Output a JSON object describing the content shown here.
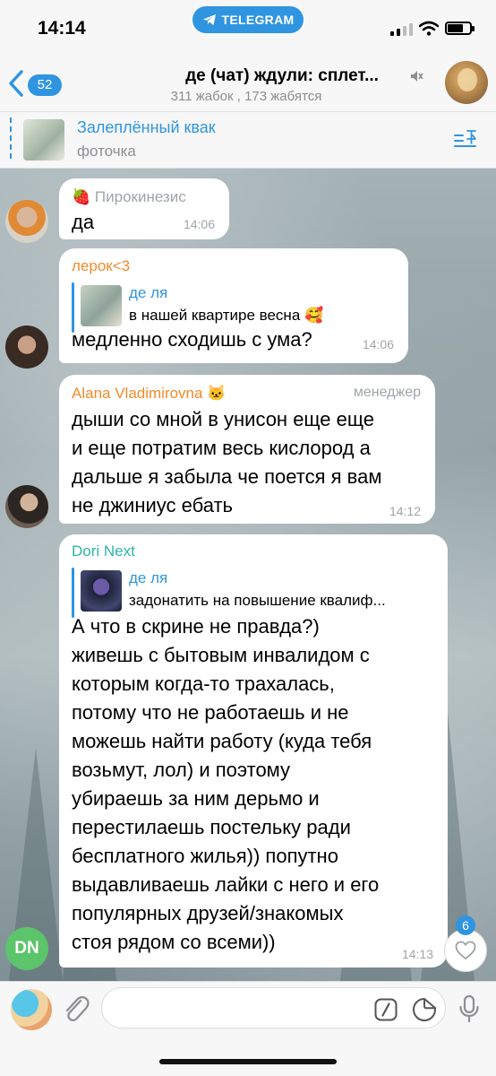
{
  "status_bar": {
    "time": "14:14",
    "app_pill": "TELEGRAM",
    "accent_color": "#2f95e1"
  },
  "header": {
    "back_badge": "52",
    "title": "де (чат) ждули: сплет...",
    "subtitle": "311 жабок , 173 жабятся",
    "icons": [
      "chevron-left-icon",
      "mute-icon"
    ]
  },
  "pinned": {
    "title": "Залеплённый квак",
    "subtitle": "фоточка"
  },
  "messages": [
    {
      "sender": "Пирокинезис",
      "sender_emoji": "🍓",
      "sender_color": "#a0a4a8",
      "lines": [
        "да"
      ],
      "time": "14:06"
    },
    {
      "sender": "лерок<3",
      "sender_color": "#f08a2a",
      "reply": {
        "author": "де ля",
        "text": "в нашей квартире весна 🥰"
      },
      "lines": [
        "медленно сходишь с ума?"
      ],
      "time": "14:06"
    },
    {
      "sender": "Alana Vladimirovna",
      "sender_emoji": "🐱",
      "sender_color": "#f08a2a",
      "admin_label": "менеджер",
      "lines": [
        "дыши со мной в унисон еще еще",
        "и еще потратим весь кислород а",
        "дальше я забыла че поется я вам",
        "не джиниус ебать"
      ],
      "time": "14:12"
    },
    {
      "sender": "Dori Next",
      "sender_color": "#2bb5a6",
      "avatar_initials": "DN",
      "reply": {
        "author": "де ля",
        "text": "задонатить на повышение квалиф..."
      },
      "lines": [
        "А что в скрине не правда?)",
        "живешь с бытовым инвалидом с",
        "которым когда-то трахалась,",
        "потому что не работаешь и не",
        "можешь найти работу (куда тебя",
        "возьмут, лол) и поэтому",
        "убираешь за ним дерьмо и",
        "перестилаешь постельку ради",
        "бесплатного жилья)) попутно",
        "выдавливаешь лайки с него и его",
        "популярных друзей/знакомых",
        "стоя рядом со всеми))"
      ],
      "time": "14:13"
    }
  ],
  "reaction": {
    "count": "6",
    "icon": "heart-icon"
  },
  "input_bar": {
    "placeholder": "",
    "icons": [
      "paperclip-icon",
      "command-icon",
      "sticker-icon",
      "microphone-icon"
    ]
  }
}
